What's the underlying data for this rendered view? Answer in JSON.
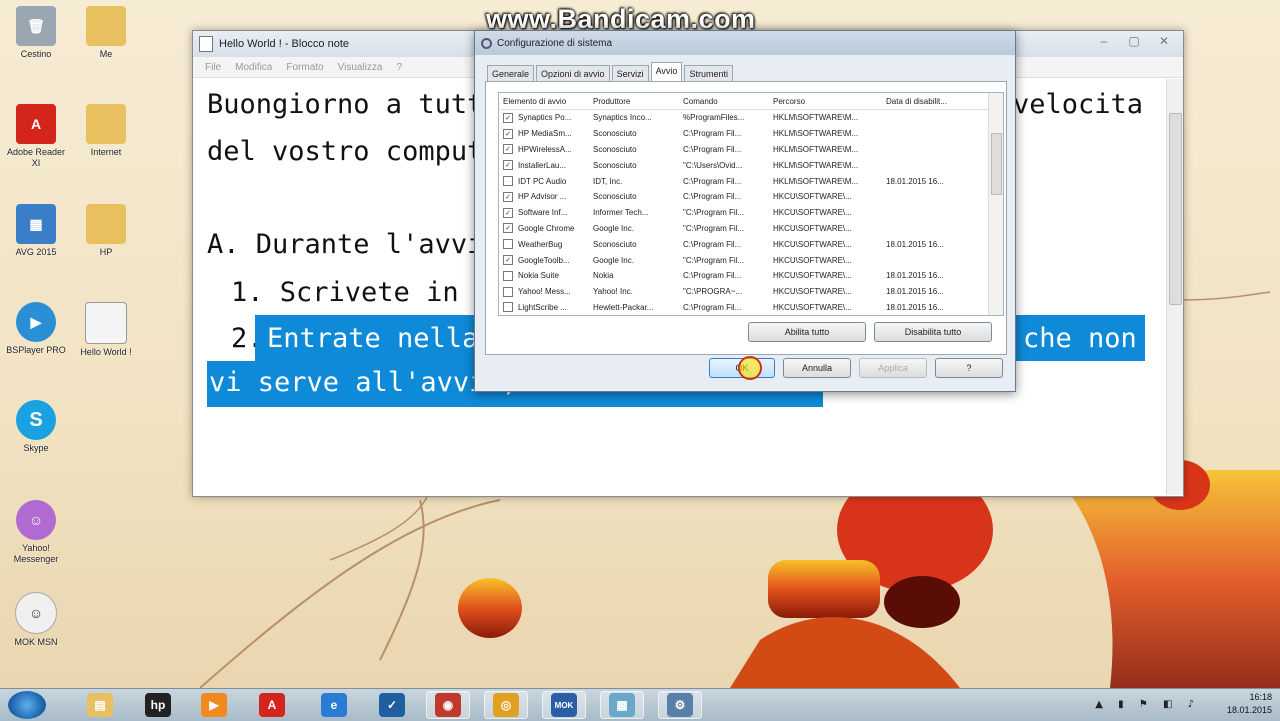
{
  "watermark": "www.Bandicam.com",
  "desktop_icons": [
    {
      "label": "Cestino",
      "icon": "recycle-bin-icon",
      "color": "#9aa6b2"
    },
    {
      "label": "Me",
      "icon": "folder-icon",
      "color": "#e8c060"
    },
    {
      "label": "Adobe Reader XI",
      "icon": "adobe-reader-icon",
      "color": "#d4251c"
    },
    {
      "label": "Internet",
      "icon": "folder-icon",
      "color": "#e8c060"
    },
    {
      "label": "AVG 2015",
      "icon": "avg-icon",
      "color": "#3a7ec8"
    },
    {
      "label": "HP",
      "icon": "folder-icon",
      "color": "#e8c060"
    },
    {
      "label": "BSPlayer PRO",
      "icon": "bsplayer-icon",
      "color": "#2b8fd6"
    },
    {
      "label": "Hello World !",
      "icon": "text-file-icon",
      "color": "#f4f4f4"
    },
    {
      "label": "Skype",
      "icon": "skype-icon",
      "color": "#1aa1e2"
    },
    {
      "label": "Yahoo! Messenger",
      "icon": "yahoo-messenger-icon",
      "color": "#b06ad0"
    },
    {
      "label": "MOK MSN",
      "icon": "mok-icon",
      "color": "#f0f0f0"
    }
  ],
  "notepad": {
    "title": "Hello World ! - Blocco note",
    "controls": [
      "–",
      "▢",
      "✕"
    ],
    "menu": [
      "File",
      "Modifica",
      "Formato",
      "Visualizza",
      "?"
    ],
    "lines": {
      "l1_left": "Buongiorno a tutti!",
      "l1_right": "velocita",
      "l2": "del vostro computer",
      "l3": "A. Durante l'avvio:",
      "l4": "1. Scrivete in cerc",
      "l5_num": "2. ",
      "l5_sel_left": "Entrate nella s",
      "l5_sel_right": "che non",
      "l6_sel": "vi serve all'avvio, ma"
    }
  },
  "dialog": {
    "title": "Configurazione di sistema",
    "tabs": [
      "Generale",
      "Opzioni di avvio",
      "Servizi",
      "Avvio",
      "Strumenti"
    ],
    "active_tab": "Avvio",
    "columns": [
      "Elemento di avvio",
      "Produttore",
      "Comando",
      "Percorso",
      "Data di disabilit..."
    ],
    "rows": [
      {
        "checked": "✓",
        "name": "Synaptics Po...",
        "maker": "Synaptics Inco...",
        "cmd": "%ProgramFiles...",
        "path": "HKLM\\SOFTWARE\\M...",
        "date": ""
      },
      {
        "checked": "✓",
        "name": "HP MediaSm...",
        "maker": "Sconosciuto",
        "cmd": "C:\\Program Fil...",
        "path": "HKLM\\SOFTWARE\\M...",
        "date": ""
      },
      {
        "checked": "✓",
        "name": "HPWirelessA...",
        "maker": "Sconosciuto",
        "cmd": "C:\\Program Fil...",
        "path": "HKLM\\SOFTWARE\\M...",
        "date": ""
      },
      {
        "checked": "✓",
        "name": "InstallerLau...",
        "maker": "Sconosciuto",
        "cmd": "\"C:\\Users\\Ovid...",
        "path": "HKLM\\SOFTWARE\\M...",
        "date": ""
      },
      {
        "checked": "",
        "name": "IDT PC Audio",
        "maker": "IDT, Inc.",
        "cmd": "C:\\Program Fil...",
        "path": "HKLM\\SOFTWARE\\M...",
        "date": "18.01.2015 16..."
      },
      {
        "checked": "✓",
        "name": "HP Advisor ...",
        "maker": "Sconosciuto",
        "cmd": "C:\\Program Fil...",
        "path": "HKCU\\SOFTWARE\\...",
        "date": ""
      },
      {
        "checked": "✓",
        "name": "Software Inf...",
        "maker": "Informer Tech...",
        "cmd": "\"C:\\Program Fil...",
        "path": "HKCU\\SOFTWARE\\...",
        "date": ""
      },
      {
        "checked": "✓",
        "name": "Google Chrome",
        "maker": "Google Inc.",
        "cmd": "\"C:\\Program Fil...",
        "path": "HKCU\\SOFTWARE\\...",
        "date": ""
      },
      {
        "checked": "",
        "name": "WeatherBug",
        "maker": "Sconosciuto",
        "cmd": "C:\\Program Fil...",
        "path": "HKCU\\SOFTWARE\\...",
        "date": "18.01.2015 16..."
      },
      {
        "checked": "✓",
        "name": "GoogleToolb...",
        "maker": "Google Inc.",
        "cmd": "\"C:\\Program Fil...",
        "path": "HKCU\\SOFTWARE\\...",
        "date": ""
      },
      {
        "checked": "",
        "name": "Nokia Suite",
        "maker": "Nokia",
        "cmd": "C:\\Program Fil...",
        "path": "HKCU\\SOFTWARE\\...",
        "date": "18.01.2015 16..."
      },
      {
        "checked": "",
        "name": "Yahoo! Mess...",
        "maker": "Yahoo! Inc.",
        "cmd": "\"C:\\PROGRA~...",
        "path": "HKCU\\SOFTWARE\\...",
        "date": "18.01.2015 16..."
      },
      {
        "checked": "",
        "name": "LightScribe ...",
        "maker": "Hewlett-Packar...",
        "cmd": "C:\\Program Fil...",
        "path": "HKCU\\SOFTWARE\\...",
        "date": "18.01.2015 16..."
      }
    ],
    "buttons": {
      "enable_all": "Abilita tutto",
      "disable_all": "Disabilita tutto",
      "ok": "OK",
      "cancel": "Annulla",
      "apply": "Applica",
      "help": "?"
    }
  },
  "taskbar": {
    "items": [
      {
        "icon": "windows-explorer-icon",
        "color": "#e8c060",
        "glyph": "▤"
      },
      {
        "icon": "hp-icon",
        "color": "#222",
        "glyph": "hp"
      },
      {
        "icon": "media-player-icon",
        "color": "#f08a1c",
        "glyph": "▶"
      },
      {
        "icon": "adobe-reader-icon",
        "color": "#d4251c",
        "glyph": "A"
      },
      {
        "icon": "internet-explorer-icon",
        "color": "#2a7bd4",
        "glyph": "e"
      },
      {
        "icon": "check-app-icon",
        "color": "#1f5fa0",
        "glyph": "✓"
      },
      {
        "icon": "bsplayer-icon",
        "color": "#c0392b",
        "glyph": "◉"
      },
      {
        "icon": "chrome-icon",
        "color": "#e0a020",
        "glyph": "◎"
      },
      {
        "icon": "mok-icon",
        "color": "#2a5fa8",
        "glyph": "MOK"
      },
      {
        "icon": "notepad-icon",
        "color": "#6aa8c8",
        "glyph": "▦"
      },
      {
        "icon": "system-config-icon",
        "color": "#5a7fa8",
        "glyph": "⚙"
      }
    ],
    "time": "16:18",
    "date": "18.01.2015"
  }
}
